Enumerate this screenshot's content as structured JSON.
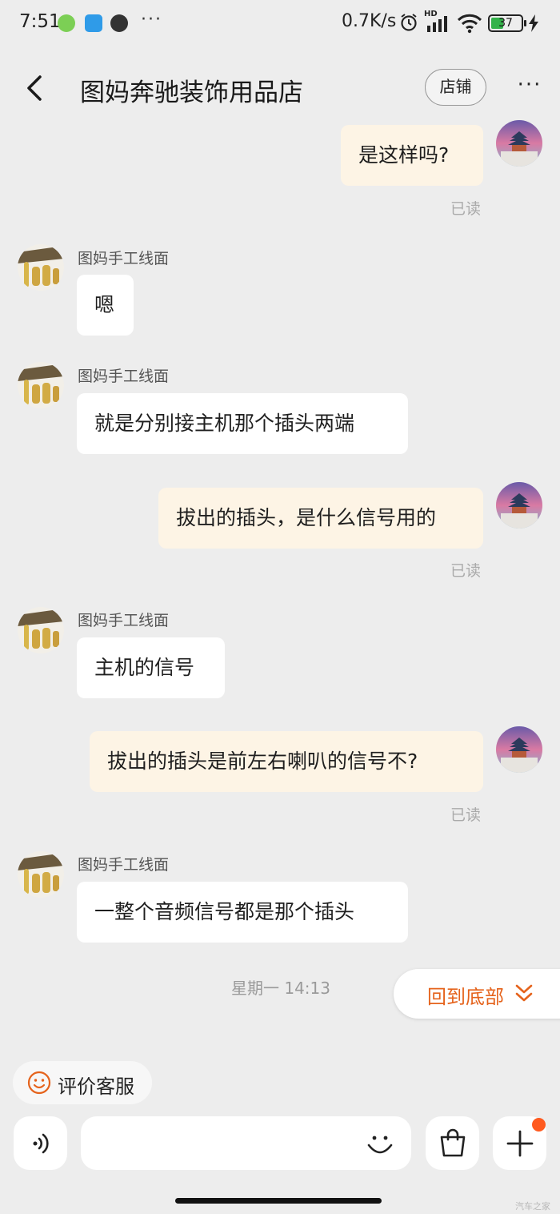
{
  "status_bar": {
    "time": "7:51",
    "dots": "···",
    "network_speed": "0.7K/s",
    "hd": "HD",
    "battery": "37"
  },
  "header": {
    "title": "图妈奔驰装饰用品店",
    "shop_label": "店铺",
    "more": "···"
  },
  "messages": [
    {
      "side": "mine",
      "text": "是这样吗?",
      "status": "已读"
    },
    {
      "side": "theirs",
      "sender": "图妈手工线面",
      "text": "嗯"
    },
    {
      "side": "theirs",
      "sender": "图妈手工线面",
      "text": "就是分别接主机那个插头两端"
    },
    {
      "side": "mine",
      "text": "拔出的插头，是什么信号用的",
      "status": "已读"
    },
    {
      "side": "theirs",
      "sender": "图妈手工线面",
      "text": "主机的信号"
    },
    {
      "side": "mine",
      "text": "拔出的插头是前左右喇叭的信号不?",
      "status": "已读"
    },
    {
      "side": "theirs",
      "sender": "图妈手工线面",
      "text": "一整个音频信号都是那个插头"
    }
  ],
  "timestamp": "星期一 14:13",
  "back_to_bottom_label": "回到底部",
  "rate_service_label": "评价客服",
  "input": {
    "value": ""
  },
  "colors": {
    "accent": "#e5631c",
    "mine_bubble": "#fdf4e5",
    "theirs_bubble": "#ffffff",
    "background": "#ededed",
    "badge": "#ff5a1f"
  },
  "watermark": "汽车之家"
}
